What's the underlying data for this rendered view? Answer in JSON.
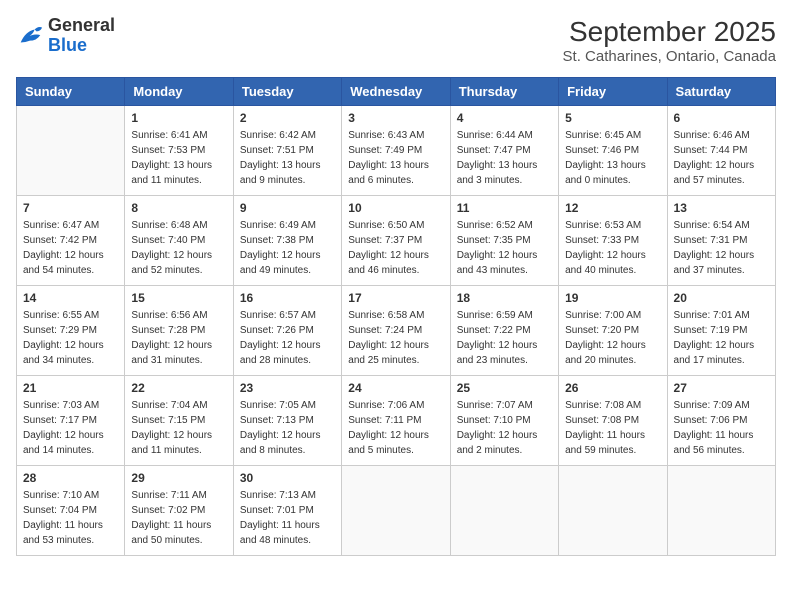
{
  "header": {
    "logo_general": "General",
    "logo_blue": "Blue",
    "title": "September 2025",
    "subtitle": "St. Catharines, Ontario, Canada"
  },
  "days_of_week": [
    "Sunday",
    "Monday",
    "Tuesday",
    "Wednesday",
    "Thursday",
    "Friday",
    "Saturday"
  ],
  "weeks": [
    [
      {
        "day": "",
        "info": ""
      },
      {
        "day": "1",
        "info": "Sunrise: 6:41 AM\nSunset: 7:53 PM\nDaylight: 13 hours\nand 11 minutes."
      },
      {
        "day": "2",
        "info": "Sunrise: 6:42 AM\nSunset: 7:51 PM\nDaylight: 13 hours\nand 9 minutes."
      },
      {
        "day": "3",
        "info": "Sunrise: 6:43 AM\nSunset: 7:49 PM\nDaylight: 13 hours\nand 6 minutes."
      },
      {
        "day": "4",
        "info": "Sunrise: 6:44 AM\nSunset: 7:47 PM\nDaylight: 13 hours\nand 3 minutes."
      },
      {
        "day": "5",
        "info": "Sunrise: 6:45 AM\nSunset: 7:46 PM\nDaylight: 13 hours\nand 0 minutes."
      },
      {
        "day": "6",
        "info": "Sunrise: 6:46 AM\nSunset: 7:44 PM\nDaylight: 12 hours\nand 57 minutes."
      }
    ],
    [
      {
        "day": "7",
        "info": "Sunrise: 6:47 AM\nSunset: 7:42 PM\nDaylight: 12 hours\nand 54 minutes."
      },
      {
        "day": "8",
        "info": "Sunrise: 6:48 AM\nSunset: 7:40 PM\nDaylight: 12 hours\nand 52 minutes."
      },
      {
        "day": "9",
        "info": "Sunrise: 6:49 AM\nSunset: 7:38 PM\nDaylight: 12 hours\nand 49 minutes."
      },
      {
        "day": "10",
        "info": "Sunrise: 6:50 AM\nSunset: 7:37 PM\nDaylight: 12 hours\nand 46 minutes."
      },
      {
        "day": "11",
        "info": "Sunrise: 6:52 AM\nSunset: 7:35 PM\nDaylight: 12 hours\nand 43 minutes."
      },
      {
        "day": "12",
        "info": "Sunrise: 6:53 AM\nSunset: 7:33 PM\nDaylight: 12 hours\nand 40 minutes."
      },
      {
        "day": "13",
        "info": "Sunrise: 6:54 AM\nSunset: 7:31 PM\nDaylight: 12 hours\nand 37 minutes."
      }
    ],
    [
      {
        "day": "14",
        "info": "Sunrise: 6:55 AM\nSunset: 7:29 PM\nDaylight: 12 hours\nand 34 minutes."
      },
      {
        "day": "15",
        "info": "Sunrise: 6:56 AM\nSunset: 7:28 PM\nDaylight: 12 hours\nand 31 minutes."
      },
      {
        "day": "16",
        "info": "Sunrise: 6:57 AM\nSunset: 7:26 PM\nDaylight: 12 hours\nand 28 minutes."
      },
      {
        "day": "17",
        "info": "Sunrise: 6:58 AM\nSunset: 7:24 PM\nDaylight: 12 hours\nand 25 minutes."
      },
      {
        "day": "18",
        "info": "Sunrise: 6:59 AM\nSunset: 7:22 PM\nDaylight: 12 hours\nand 23 minutes."
      },
      {
        "day": "19",
        "info": "Sunrise: 7:00 AM\nSunset: 7:20 PM\nDaylight: 12 hours\nand 20 minutes."
      },
      {
        "day": "20",
        "info": "Sunrise: 7:01 AM\nSunset: 7:19 PM\nDaylight: 12 hours\nand 17 minutes."
      }
    ],
    [
      {
        "day": "21",
        "info": "Sunrise: 7:03 AM\nSunset: 7:17 PM\nDaylight: 12 hours\nand 14 minutes."
      },
      {
        "day": "22",
        "info": "Sunrise: 7:04 AM\nSunset: 7:15 PM\nDaylight: 12 hours\nand 11 minutes."
      },
      {
        "day": "23",
        "info": "Sunrise: 7:05 AM\nSunset: 7:13 PM\nDaylight: 12 hours\nand 8 minutes."
      },
      {
        "day": "24",
        "info": "Sunrise: 7:06 AM\nSunset: 7:11 PM\nDaylight: 12 hours\nand 5 minutes."
      },
      {
        "day": "25",
        "info": "Sunrise: 7:07 AM\nSunset: 7:10 PM\nDaylight: 12 hours\nand 2 minutes."
      },
      {
        "day": "26",
        "info": "Sunrise: 7:08 AM\nSunset: 7:08 PM\nDaylight: 11 hours\nand 59 minutes."
      },
      {
        "day": "27",
        "info": "Sunrise: 7:09 AM\nSunset: 7:06 PM\nDaylight: 11 hours\nand 56 minutes."
      }
    ],
    [
      {
        "day": "28",
        "info": "Sunrise: 7:10 AM\nSunset: 7:04 PM\nDaylight: 11 hours\nand 53 minutes."
      },
      {
        "day": "29",
        "info": "Sunrise: 7:11 AM\nSunset: 7:02 PM\nDaylight: 11 hours\nand 50 minutes."
      },
      {
        "day": "30",
        "info": "Sunrise: 7:13 AM\nSunset: 7:01 PM\nDaylight: 11 hours\nand 48 minutes."
      },
      {
        "day": "",
        "info": ""
      },
      {
        "day": "",
        "info": ""
      },
      {
        "day": "",
        "info": ""
      },
      {
        "day": "",
        "info": ""
      }
    ]
  ]
}
